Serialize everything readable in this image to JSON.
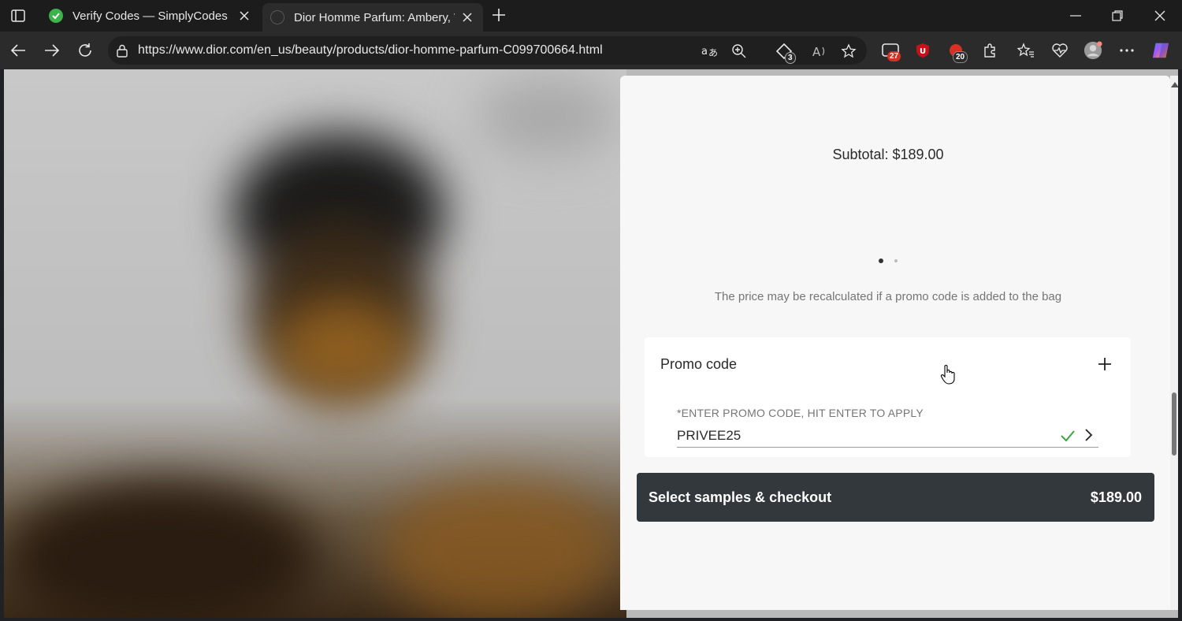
{
  "browser": {
    "tabs": [
      {
        "title": "Verify Codes — SimplyCodes",
        "active": false,
        "favicon": "simplycodes-icon"
      },
      {
        "title": "Dior Homme Parfum: Ambery, Wc",
        "active": true,
        "favicon": "dior-icon"
      }
    ],
    "url": "https://www.dior.com/en_us/beauty/products/dior-homme-parfum-C099700664.html",
    "extensions": [
      {
        "name": "coupon-extension",
        "badge": "3"
      },
      {
        "name": "capture-extension",
        "badge": "27"
      },
      {
        "name": "ublock-extension",
        "badge": ""
      },
      {
        "name": "alerts-extension",
        "badge": "20"
      }
    ]
  },
  "page": {
    "subtotal": "Subtotal: $189.00",
    "notice": "The price may be recalculated if a promo code is added to the bag",
    "promo": {
      "title": "Promo code",
      "field_label": "*ENTER PROMO CODE, HIT ENTER TO APPLY",
      "value": "PRIVEE25"
    },
    "checkout": {
      "label": "Select samples & checkout",
      "amount": "$189.00"
    }
  },
  "colors": {
    "checkout_bg": "#33383c",
    "check_green": "#3aa63f",
    "panel_bg": "#f7f7f7"
  }
}
